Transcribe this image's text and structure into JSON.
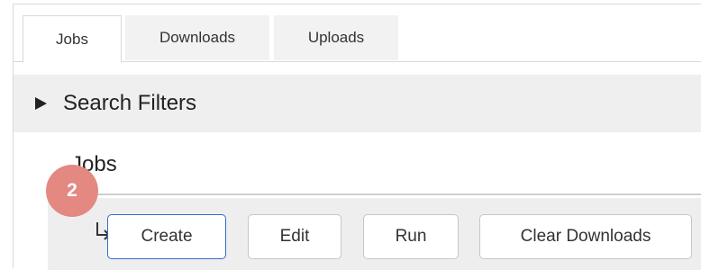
{
  "tabs": [
    {
      "label": "Jobs",
      "active": true
    },
    {
      "label": "Downloads",
      "active": false
    },
    {
      "label": "Uploads",
      "active": false
    }
  ],
  "filters": {
    "label": "Search Filters",
    "icon": "caret-right-icon"
  },
  "jobs": {
    "title": "Jobs",
    "toolbar": {
      "icon": "subdirectory-arrow-icon",
      "create_label": "Create",
      "edit_label": "Edit",
      "run_label": "Run",
      "clear_label": "Clear Downloads"
    }
  },
  "step_badge": {
    "number": "2",
    "color": "#e38982"
  },
  "colors": {
    "primary_border": "#2f6cc8",
    "panel_bg": "#efefef"
  }
}
